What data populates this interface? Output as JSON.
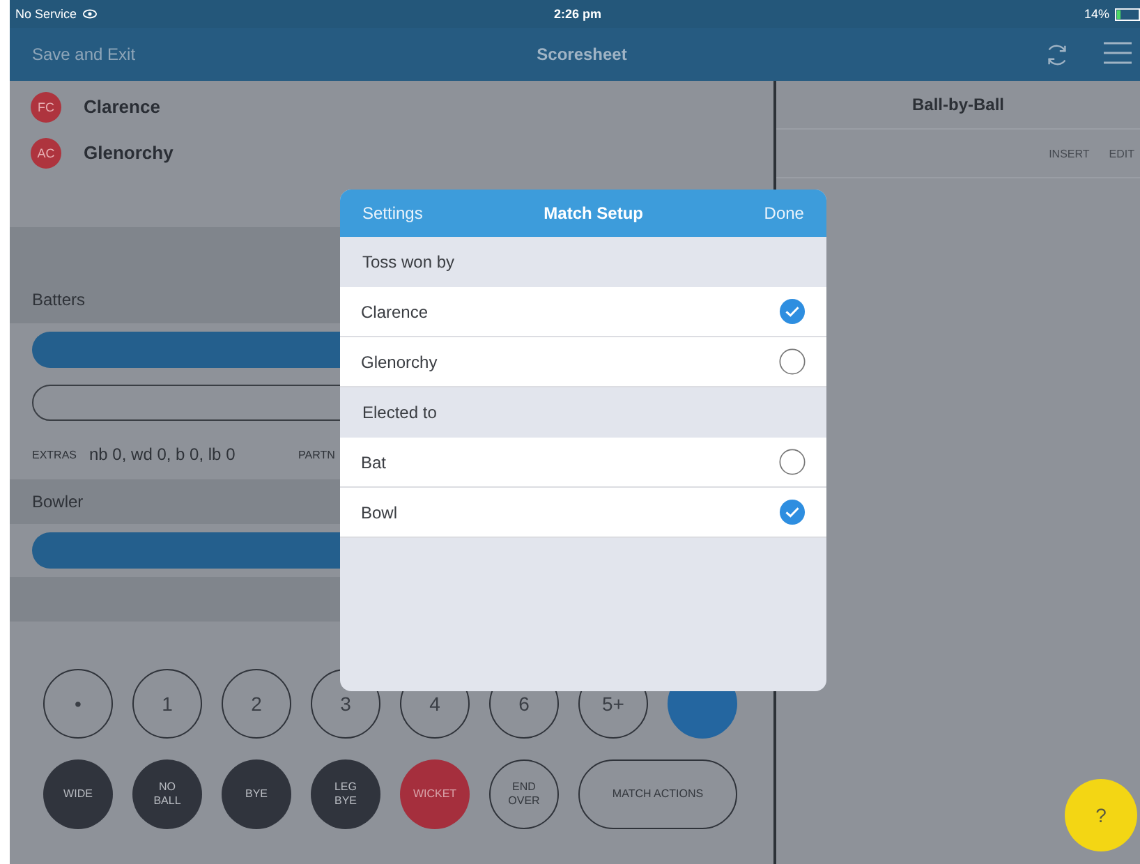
{
  "status_bar": {
    "carrier": "No Service",
    "time": "2:26 pm",
    "battery": "14%"
  },
  "nav_bar": {
    "left": "Save and Exit",
    "title": "Scoresheet"
  },
  "teams": [
    {
      "initials": "FC",
      "name": "Clarence"
    },
    {
      "initials": "AC",
      "name": "Glenorchy"
    }
  ],
  "batters": {
    "heading": "Batters"
  },
  "extras": {
    "label": "EXTRAS",
    "value": "nb 0, wd 0, b 0, lb 0",
    "partnership_label": "PARTN"
  },
  "bowler": {
    "heading": "Bowler"
  },
  "run_buttons": [
    {
      "label": "•",
      "kind": "outline"
    },
    {
      "label": "1",
      "kind": "outline"
    },
    {
      "label": "2",
      "kind": "outline"
    },
    {
      "label": "3",
      "kind": "outline"
    },
    {
      "label": "4",
      "kind": "outline"
    },
    {
      "label": "6",
      "kind": "outline"
    },
    {
      "label": "5+",
      "kind": "outline"
    },
    {
      "kind": "filled"
    }
  ],
  "action_buttons": [
    {
      "label": "WIDE",
      "kind": "dark"
    },
    {
      "label": "NO\nBALL",
      "kind": "dark"
    },
    {
      "label": "BYE",
      "kind": "dark"
    },
    {
      "label": "LEG\nBYE",
      "kind": "dark"
    },
    {
      "label": "WICKET",
      "kind": "danger"
    },
    {
      "label": "END\nOVER",
      "kind": "outline"
    },
    {
      "label": "MATCH ACTIONS",
      "kind": "pill"
    }
  ],
  "ball_by_ball": {
    "title": "Ball-by-Ball",
    "actions": [
      "INSERT",
      "EDIT"
    ]
  },
  "modal": {
    "left": "Settings",
    "title": "Match Setup",
    "right": "Done",
    "sections": [
      {
        "heading": "Toss won by",
        "options": [
          {
            "label": "Clarence",
            "selected": true
          },
          {
            "label": "Glenorchy",
            "selected": false
          }
        ]
      },
      {
        "heading": "Elected to",
        "options": [
          {
            "label": "Bat",
            "selected": false
          },
          {
            "label": "Bowl",
            "selected": true
          }
        ]
      }
    ]
  },
  "help_button": {
    "label": "?"
  }
}
